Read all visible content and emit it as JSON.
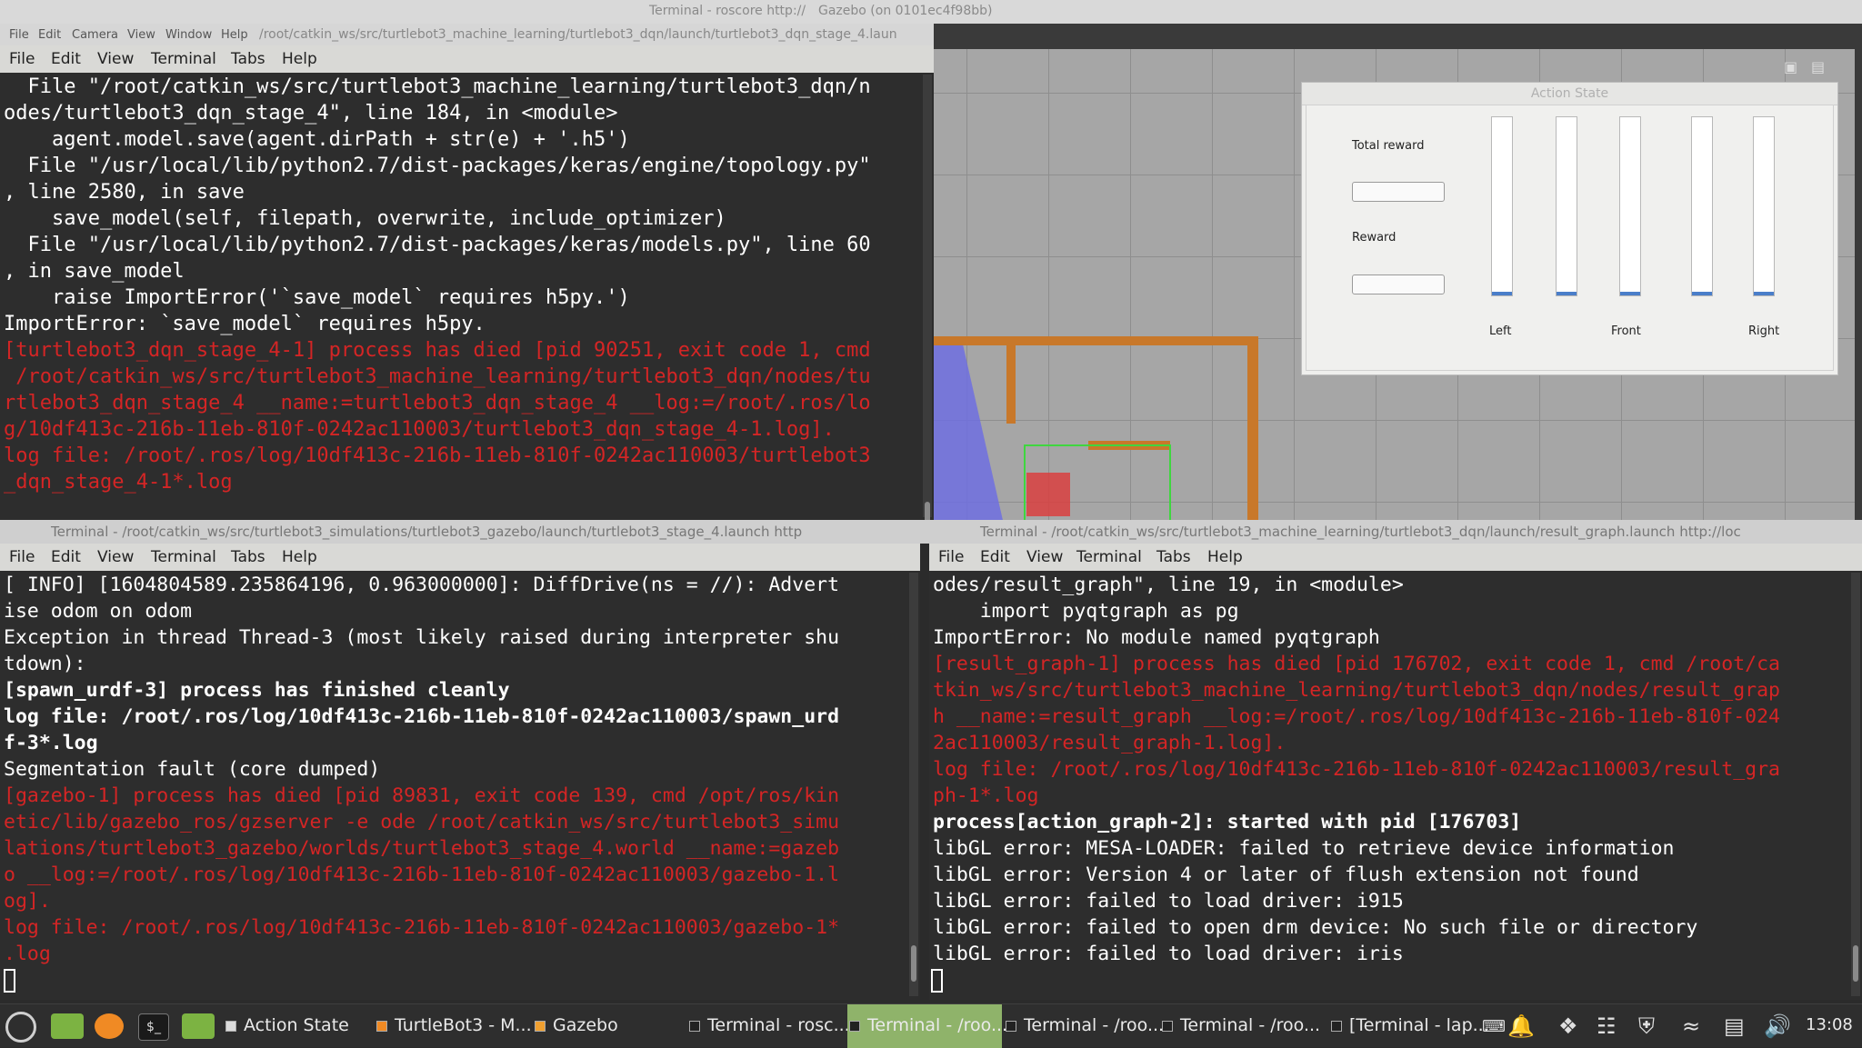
{
  "top_bar": {
    "title_terminal_roscore": "Terminal - roscore http://",
    "title_gazebo": "Gazebo (on 0101ec4f98bb)"
  },
  "gazebo_menu": [
    "File",
    "Edit",
    "Camera",
    "View",
    "Window",
    "Help"
  ],
  "term1_title": "/root/catkin_ws/src/turtlebot3_machine_learning/turtlebot3_dqn/launch/turtlebot3_dqn_stage_4.laun",
  "term2_title": "Terminal - /root/catkin_ws/src/turtlebot3_simulations/turtlebot3_gazebo/launch/turtlebot3_stage_4.launch http",
  "term3_title": "Terminal - /root/catkin_ws/src/turtlebot3_machine_learning/turtlebot3_dqn/launch/result_graph.launch http://loc",
  "terminal_menu": [
    "File",
    "Edit",
    "View",
    "Terminal",
    "Tabs",
    "Help"
  ],
  "action_state": {
    "title": "Action State",
    "total_reward_label": "Total reward",
    "reward_label": "Reward",
    "bar_labels": [
      "Left",
      "Front",
      "Right"
    ],
    "bar_levels": [
      0.01,
      0.01,
      0.01,
      0.01,
      0.01
    ]
  },
  "term1_lines": [
    {
      "t": "  File \"/root/catkin_ws/src/turtlebot3_machine_learning/turtlebot3_dqn/n",
      "s": ""
    },
    {
      "t": "odes/turtlebot3_dqn_stage_4\", line 184, in <module>",
      "s": ""
    },
    {
      "t": "    agent.model.save(agent.dirPath + str(e) + '.h5')",
      "s": ""
    },
    {
      "t": "  File \"/usr/local/lib/python2.7/dist-packages/keras/engine/topology.py\"",
      "s": ""
    },
    {
      "t": ", line 2580, in save",
      "s": ""
    },
    {
      "t": "    save_model(self, filepath, overwrite, include_optimizer)",
      "s": ""
    },
    {
      "t": "  File \"/usr/local/lib/python2.7/dist-packages/keras/models.py\", line 60",
      "s": ""
    },
    {
      "t": ", in save_model",
      "s": ""
    },
    {
      "t": "    raise ImportError('`save_model` requires h5py.')",
      "s": ""
    },
    {
      "t": "ImportError: `save_model` requires h5py.",
      "s": ""
    },
    {
      "t": "[turtlebot3_dqn_stage_4-1] process has died [pid 90251, exit code 1, cmd",
      "s": "red"
    },
    {
      "t": " /root/catkin_ws/src/turtlebot3_machine_learning/turtlebot3_dqn/nodes/tu",
      "s": "red"
    },
    {
      "t": "rtlebot3_dqn_stage_4 __name:=turtlebot3_dqn_stage_4 __log:=/root/.ros/lo",
      "s": "red"
    },
    {
      "t": "g/10df413c-216b-11eb-810f-0242ac110003/turtlebot3_dqn_stage_4-1.log].",
      "s": "red"
    },
    {
      "t": "log file: /root/.ros/log/10df413c-216b-11eb-810f-0242ac110003/turtlebot3",
      "s": "red"
    },
    {
      "t": "_dqn_stage_4-1*.log",
      "s": "red"
    }
  ],
  "term2_lines": [
    {
      "t": "[ INFO] [1604804589.235864196, 0.963000000]: DiffDrive(ns = //): Advert",
      "s": ""
    },
    {
      "t": "ise odom on odom",
      "s": ""
    },
    {
      "t": "Exception in thread Thread-3 (most likely raised during interpreter shu",
      "s": ""
    },
    {
      "t": "tdown):",
      "s": ""
    },
    {
      "t": "[spawn_urdf-3] process has finished cleanly",
      "s": "bold"
    },
    {
      "t": "log file: /root/.ros/log/10df413c-216b-11eb-810f-0242ac110003/spawn_urd",
      "s": "bold"
    },
    {
      "t": "f-3*.log",
      "s": "bold"
    },
    {
      "t": "Segmentation fault (core dumped)",
      "s": ""
    },
    {
      "t": "[gazebo-1] process has died [pid 89831, exit code 139, cmd /opt/ros/kin",
      "s": "red"
    },
    {
      "t": "etic/lib/gazebo_ros/gzserver -e ode /root/catkin_ws/src/turtlebot3_simu",
      "s": "red"
    },
    {
      "t": "lations/turtlebot3_gazebo/worlds/turtlebot3_stage_4.world __name:=gazeb",
      "s": "red"
    },
    {
      "t": "o __log:=/root/.ros/log/10df413c-216b-11eb-810f-0242ac110003/gazebo-1.l",
      "s": "red"
    },
    {
      "t": "og].",
      "s": "red"
    },
    {
      "t": "log file: /root/.ros/log/10df413c-216b-11eb-810f-0242ac110003/gazebo-1*",
      "s": "red"
    },
    {
      "t": ".log",
      "s": "red"
    }
  ],
  "term3_lines": [
    {
      "t": "odes/result_graph\", line 19, in <module>",
      "s": ""
    },
    {
      "t": "    import pyqtgraph as pg",
      "s": ""
    },
    {
      "t": "ImportError: No module named pyqtgraph",
      "s": ""
    },
    {
      "t": "[result_graph-1] process has died [pid 176702, exit code 1, cmd /root/ca",
      "s": "red"
    },
    {
      "t": "tkin_ws/src/turtlebot3_machine_learning/turtlebot3_dqn/nodes/result_grap",
      "s": "red"
    },
    {
      "t": "h __name:=result_graph __log:=/root/.ros/log/10df413c-216b-11eb-810f-024",
      "s": "red"
    },
    {
      "t": "2ac110003/result_graph-1.log].",
      "s": "red"
    },
    {
      "t": "log file: /root/.ros/log/10df413c-216b-11eb-810f-0242ac110003/result_gra",
      "s": "red"
    },
    {
      "t": "ph-1*.log",
      "s": "red"
    },
    {
      "t": "process[action_graph-2]: started with pid [176703]",
      "s": "bold"
    },
    {
      "t": "libGL error: MESA-LOADER: failed to retrieve device information",
      "s": ""
    },
    {
      "t": "libGL error: Version 4 or later of flush extension not found",
      "s": ""
    },
    {
      "t": "libGL error: failed to load driver: i915",
      "s": ""
    },
    {
      "t": "libGL error: failed to open drm device: No such file or directory",
      "s": ""
    },
    {
      "t": "libGL error: failed to load driver: iris",
      "s": ""
    }
  ],
  "taskbar": {
    "items": [
      {
        "label": "Action State",
        "icon": "window-icon",
        "active": false
      },
      {
        "label": "TurtleBot3 - M...",
        "icon": "firefox-icon",
        "active": false
      },
      {
        "label": "Gazebo",
        "icon": "gazebo-icon",
        "active": false
      },
      {
        "label": "Terminal - rosc...",
        "icon": "terminal-icon",
        "active": false
      },
      {
        "label": "Terminal - /roo...",
        "icon": "terminal-icon",
        "active": true
      },
      {
        "label": "Terminal - /roo...",
        "icon": "terminal-icon",
        "active": false
      },
      {
        "label": "Terminal - /roo...",
        "icon": "terminal-icon",
        "active": false
      },
      {
        "label": "[Terminal - lap...",
        "icon": "terminal-icon",
        "active": false
      }
    ],
    "clock": "13:08"
  },
  "colors": {
    "terminal_bg": "#2d2d2d",
    "error_red": "#d42525",
    "active_task": "#8fb36a",
    "wall_orange": "#c8782a"
  }
}
